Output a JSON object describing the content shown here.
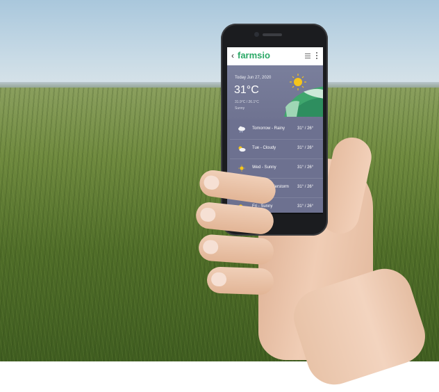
{
  "app": {
    "brand_prefix": "farms",
    "brand_suffix": "io",
    "back_icon": "chevron-left-icon",
    "menu_icon": "list-icon",
    "overflow_icon": "more-vertical-icon"
  },
  "today": {
    "date": "Today Jun 27, 2020",
    "temperature": "31°C",
    "range": "31.9°C / 26.1°C",
    "condition": "Sunny"
  },
  "forecast": [
    {
      "label": "Tomorrow  -  Rainy",
      "temps": "31° / 26°",
      "icon": "cloud-rain-icon"
    },
    {
      "label": "Tue - Cloudy",
      "temps": "31° / 26°",
      "icon": "partly-cloudy-icon"
    },
    {
      "label": "Wed - Sunny",
      "temps": "31° / 26°",
      "icon": "sun-icon"
    },
    {
      "label": "Thu - Thunderstorm",
      "temps": "31° / 26°",
      "icon": "thunderstorm-icon"
    },
    {
      "label": "Fri - Sunny",
      "temps": "31° / 26°",
      "icon": "partly-sunny-icon"
    }
  ],
  "colors": {
    "brand_green": "#2aa866",
    "panel": "#6d7190",
    "sun": "#f5c51b"
  }
}
